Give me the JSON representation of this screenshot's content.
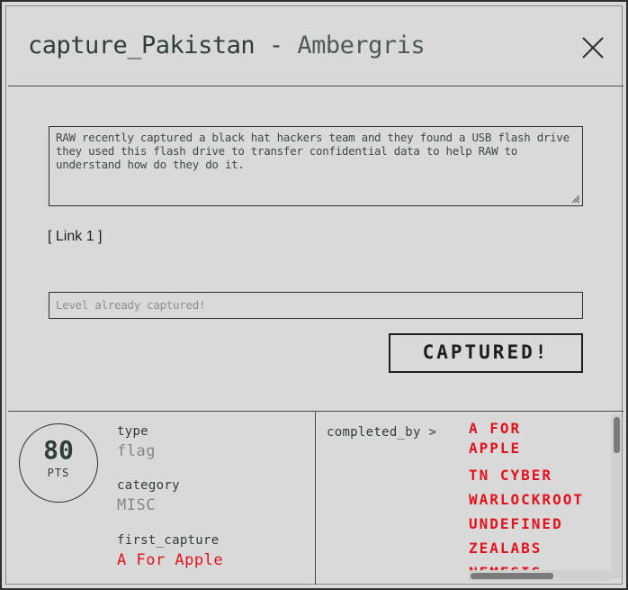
{
  "modal": {
    "title_challenge": "capture_Pakistan",
    "title_separator": "-",
    "title_author": "Ambergris",
    "description": "RAW recently captured a black hat hackers team and they found a USB flash drive they used this flash drive to transfer confidential data to help RAW to understand how do they do it.",
    "link_label": "[ Link 1 ]",
    "flag_input": {
      "placeholder": "Level already captured!",
      "value": ""
    },
    "submit_label": "CAPTURED!"
  },
  "stats": {
    "points_value": "80",
    "points_unit": "PTS",
    "type_label": "type",
    "type_value": "flag",
    "category_label": "category",
    "category_value": "MISC",
    "first_capture_label": "first_capture",
    "first_capture_value": "A For Apple"
  },
  "completed": {
    "label": "completed_by >",
    "teams": [
      "A FOR APPLE",
      "TN CYBER",
      "WARLOCKROOT",
      "UNDEFINED",
      "ZEALABS",
      "NEMESIS"
    ]
  },
  "colors": {
    "background": "#d9d9d9",
    "text": "#2f3d3d",
    "accent_red": "#e3121c",
    "muted": "#808a8a"
  }
}
